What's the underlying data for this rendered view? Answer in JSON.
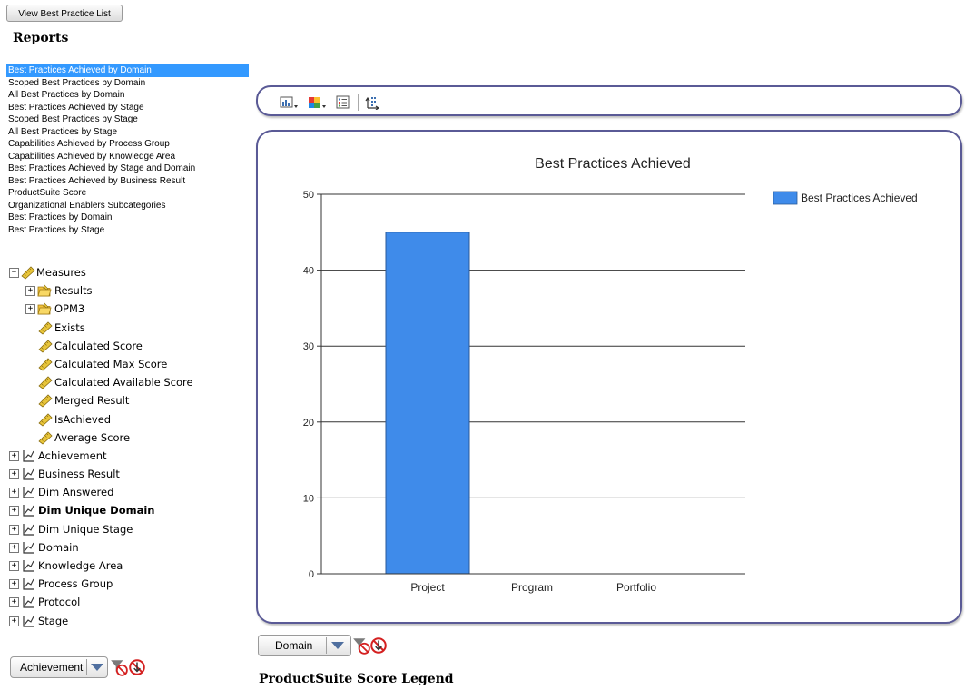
{
  "top_button": "View Best Practice List",
  "reports_title": "Reports",
  "reports": [
    "Best Practices Achieved by Domain",
    "Scoped Best Practices by Domain",
    "All Best Practices by Domain",
    "Best Practices Achieved by Stage",
    "Scoped Best Practices by Stage",
    "All Best Practices by Stage",
    "Capabilities Achieved by Process Group",
    "Capabilities Achieved by Knowledge Area",
    "Best Practices Achieved by Stage and Domain",
    "Best Practices Achieved by Business Result",
    "ProductSuite Score",
    "Organizational Enablers Subcategories",
    "Best Practices by Domain",
    "Best Practices by Stage"
  ],
  "tree": {
    "measures": "Measures",
    "results": "Results",
    "opm3": "OPM3",
    "exists": "Exists",
    "calculated_score": "Calculated Score",
    "calculated_max_score": "Calculated Max Score",
    "calculated_available_score": "Calculated Available Score",
    "merged_result": "Merged Result",
    "is_achieved": "IsAchieved",
    "average_score": "Average Score",
    "achievement": "Achievement",
    "business_result": "Business Result",
    "dim_answered": "Dim Answered",
    "dim_unique_domain": "Dim Unique Domain",
    "dim_unique_stage": "Dim Unique Stage",
    "domain": "Domain",
    "knowledge_area": "Knowledge Area",
    "process_group": "Process Group",
    "protocol": "Protocol",
    "stage": "Stage"
  },
  "left_dropdown": "Achievement",
  "chart_dropdown": "Domain",
  "legend_heading": "ProductSuite Score Legend",
  "colors": {
    "bar": "#3f8bea",
    "selection": "#3399ff",
    "panel_border": "#5a5a96"
  },
  "chart_data": {
    "type": "bar",
    "title": "Best Practices Achieved",
    "categories": [
      "Project",
      "Program",
      "Portfolio"
    ],
    "series": [
      {
        "name": "Best Practices Achieved",
        "values": [
          45,
          0,
          0
        ]
      }
    ],
    "ylim": [
      0,
      50
    ],
    "yticks": [
      "0",
      "10",
      "20",
      "30",
      "40",
      "50"
    ],
    "grid": true,
    "legend_position": "top-right"
  }
}
